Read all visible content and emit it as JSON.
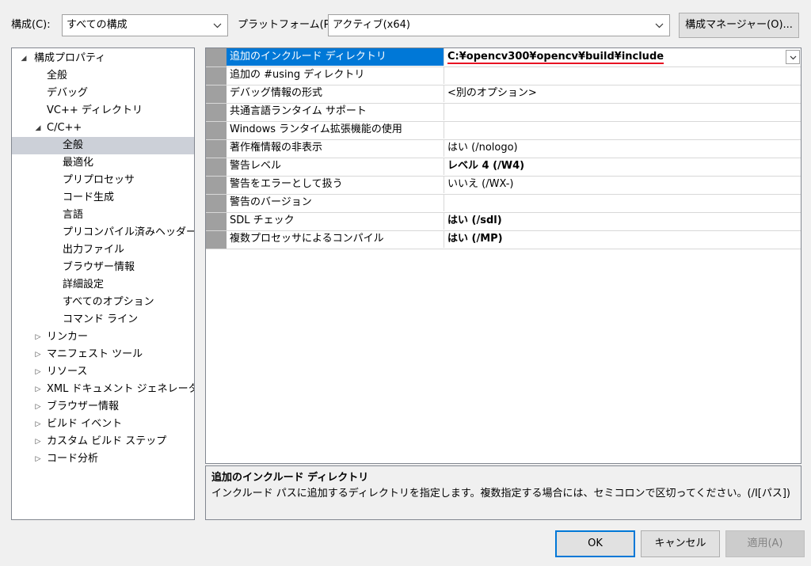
{
  "toolbar": {
    "config_label": "構成(C):",
    "config_value": "すべての構成",
    "platform_label": "プラットフォーム(P):",
    "platform_value": "アクティブ(x64)",
    "config_manager_label": "構成マネージャー(O)..."
  },
  "tree": {
    "root": "構成プロパティ",
    "general": "全般",
    "debug": "デバッグ",
    "vc_dirs": "VC++ ディレクトリ",
    "cpp": "C/C++",
    "cpp_children": [
      "全般",
      "最適化",
      "プリプロセッサ",
      "コード生成",
      "言語",
      "プリコンパイル済みヘッダー",
      "出力ファイル",
      "ブラウザー情報",
      "詳細設定",
      "すべてのオプション",
      "コマンド ライン"
    ],
    "collapsed": [
      "リンカー",
      "マニフェスト ツール",
      "リソース",
      "XML ドキュメント ジェネレーター",
      "ブラウザー情報",
      "ビルド イベント",
      "カスタム ビルド ステップ",
      "コード分析"
    ]
  },
  "grid": {
    "rows": [
      {
        "name": "追加のインクルード ディレクトリ",
        "value": "C:¥opencv300¥opencv¥build¥include"
      },
      {
        "name": "追加の #using ディレクトリ",
        "value": ""
      },
      {
        "name": "デバッグ情報の形式",
        "value": "<別のオプション>"
      },
      {
        "name": "共通言語ランタイム サポート",
        "value": ""
      },
      {
        "name": "Windows ランタイム拡張機能の使用",
        "value": ""
      },
      {
        "name": "著作権情報の非表示",
        "value": "はい (/nologo)"
      },
      {
        "name": "警告レベル",
        "value": "レベル 4 (/W4)"
      },
      {
        "name": "警告をエラーとして扱う",
        "value": "いいえ (/WX-)"
      },
      {
        "name": "警告のバージョン",
        "value": ""
      },
      {
        "name": "SDL チェック",
        "value": "はい (/sdl)"
      },
      {
        "name": "複数プロセッサによるコンパイル",
        "value": "はい (/MP)"
      }
    ]
  },
  "description": {
    "title": "追加のインクルード ディレクトリ",
    "text": "インクルード パスに追加するディレクトリを指定します。複数指定する場合には、セミコロンで区切ってください。(/I[パス])"
  },
  "buttons": {
    "ok": "OK",
    "cancel": "キャンセル",
    "apply": "適用(A)"
  },
  "colors": {
    "selection": "#0078d7",
    "underline": "#e81123",
    "tree_selection": "#ccd0d8"
  },
  "icons": {
    "expanded": "black-down-triangle",
    "collapsed": "white-right-triangle",
    "dropdown": "chevron-down"
  }
}
